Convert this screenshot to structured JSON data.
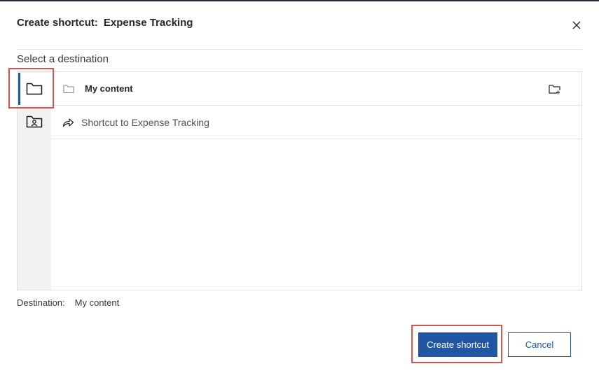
{
  "dialog": {
    "title_prefix": "Create shortcut:",
    "title_name": "Expense Tracking",
    "subtitle": "Select a destination"
  },
  "rail": {
    "items": [
      {
        "icon": "folder-icon",
        "active": true
      },
      {
        "icon": "shared-folder-icon",
        "active": false
      }
    ]
  },
  "list": {
    "header_label": "My content",
    "items": [
      {
        "label": "Shortcut to Expense Tracking",
        "icon": "shortcut-arrow-icon"
      }
    ]
  },
  "destination": {
    "label": "Destination:",
    "value": "My content"
  },
  "buttons": {
    "create": "Create shortcut",
    "cancel": "Cancel"
  },
  "colors": {
    "primary": "#1f57a4",
    "highlight": "#d9534f",
    "rail_bg": "#f2f2f2",
    "border": "#e0e0e0"
  }
}
